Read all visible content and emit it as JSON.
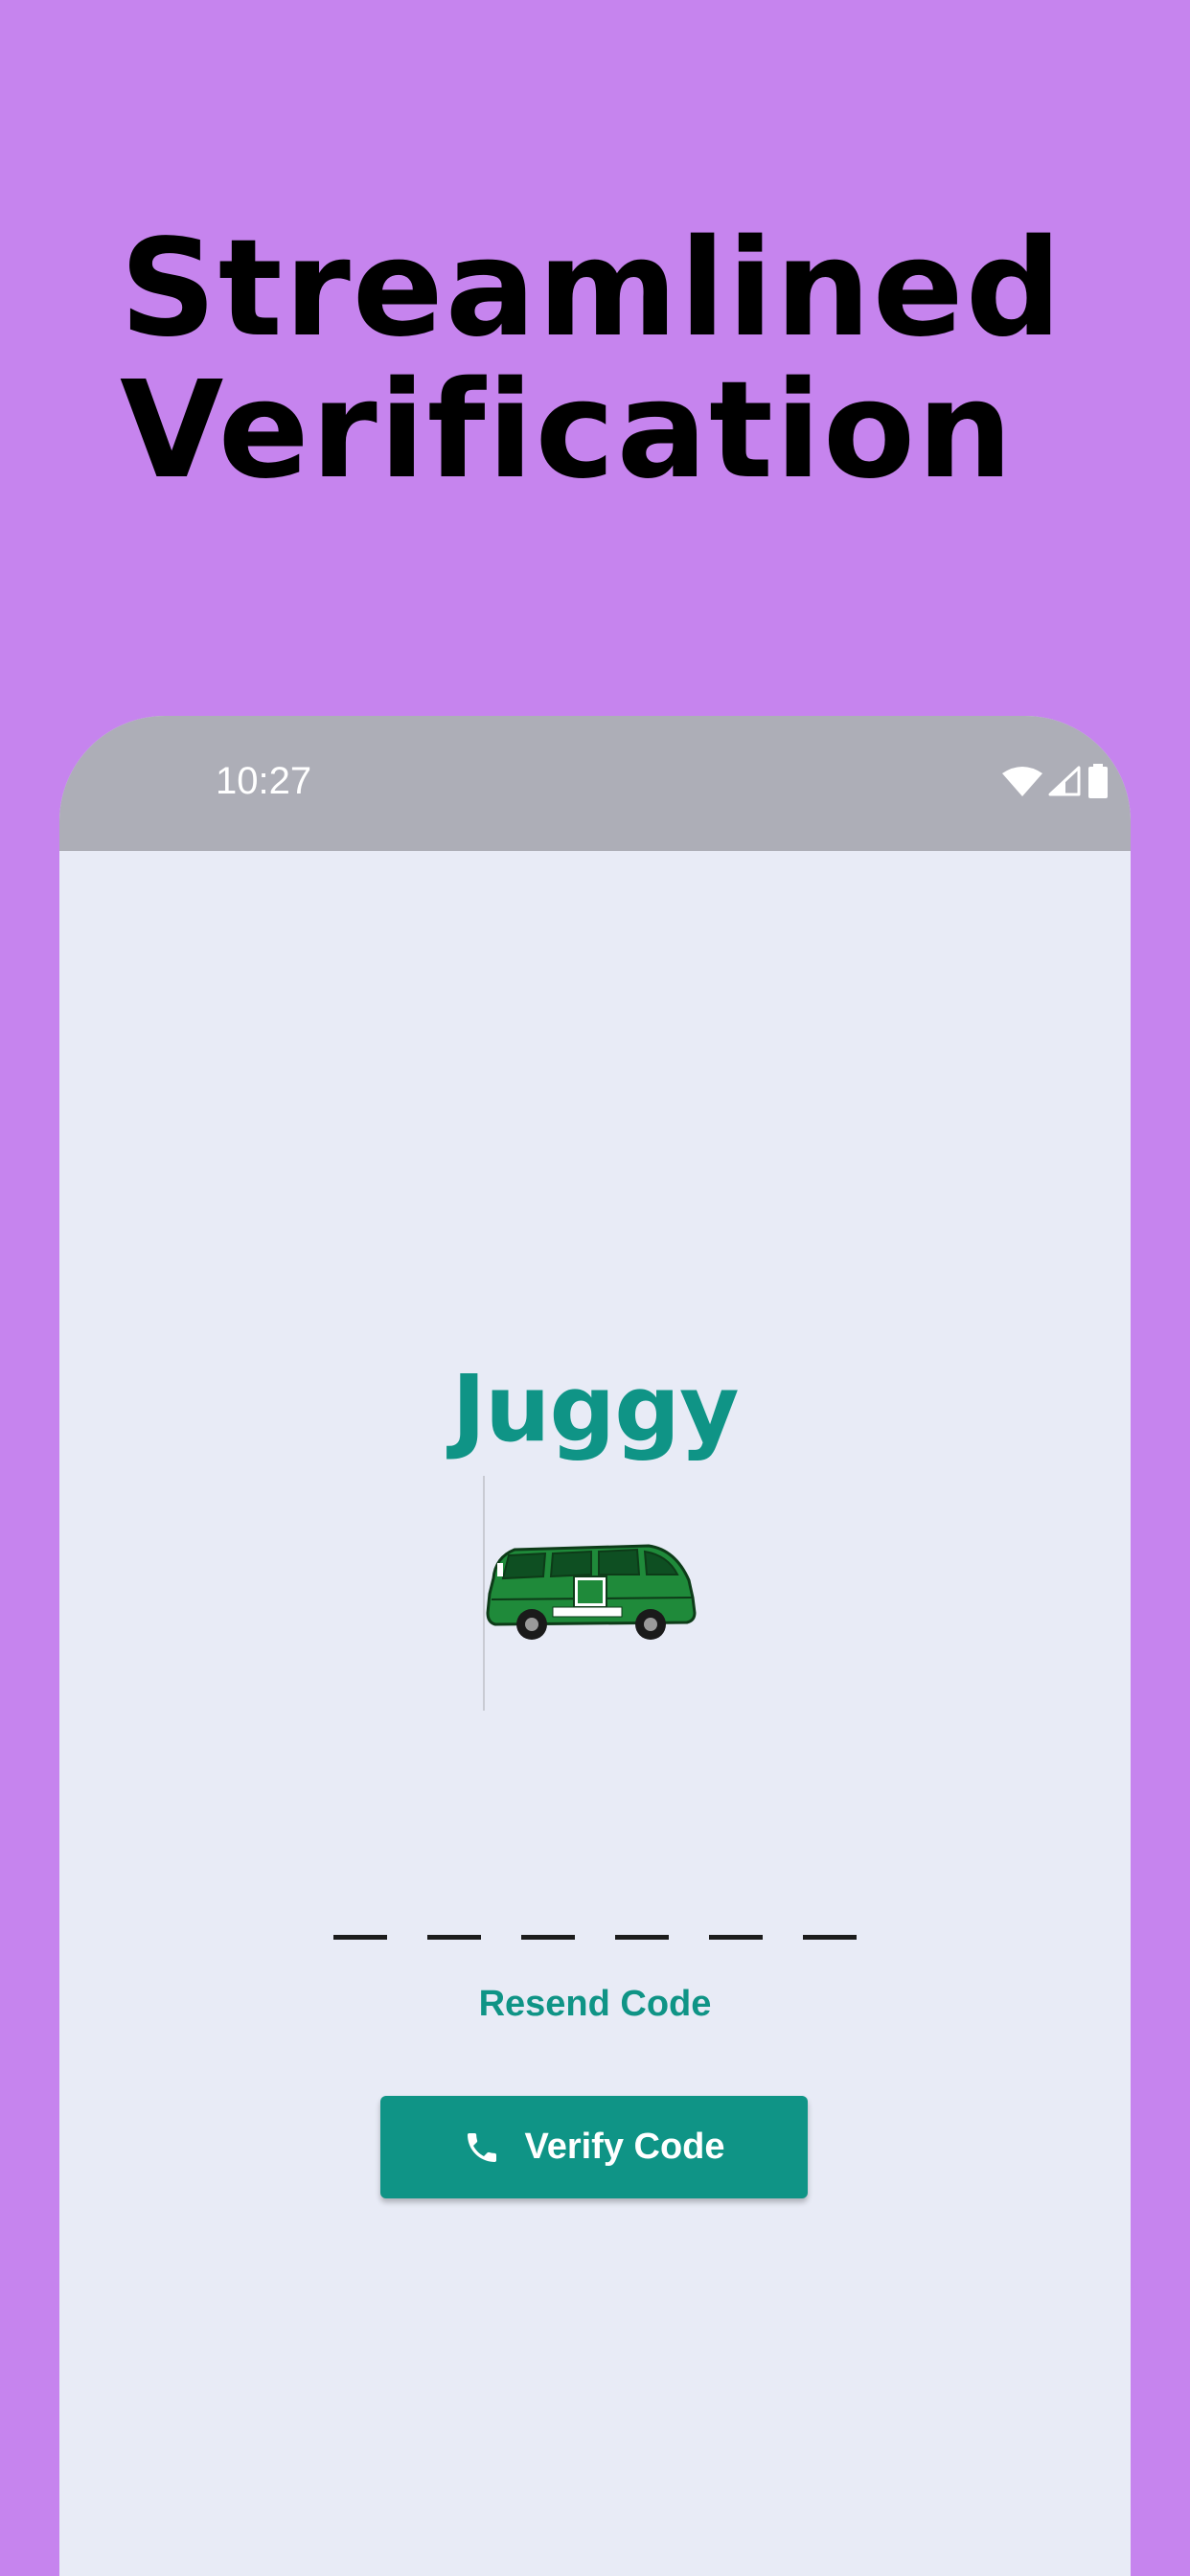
{
  "promo": {
    "headline_line1": "Streamlined",
    "headline_line2": "Verification"
  },
  "status_bar": {
    "time": "10:27",
    "icons": [
      "wifi-icon",
      "cellular-signal-icon",
      "battery-icon"
    ]
  },
  "app": {
    "name": "Juggy",
    "logo": "green-van-logo"
  },
  "verification": {
    "code_slots": 6,
    "resend_label": "Resend Code",
    "verify_label": "Verify Code",
    "verify_icon": "phone-icon"
  },
  "colors": {
    "background": "#c684ee",
    "accent": "#0f9486",
    "screen": "#e8ebf6",
    "status_bar": "#adaeb7"
  }
}
